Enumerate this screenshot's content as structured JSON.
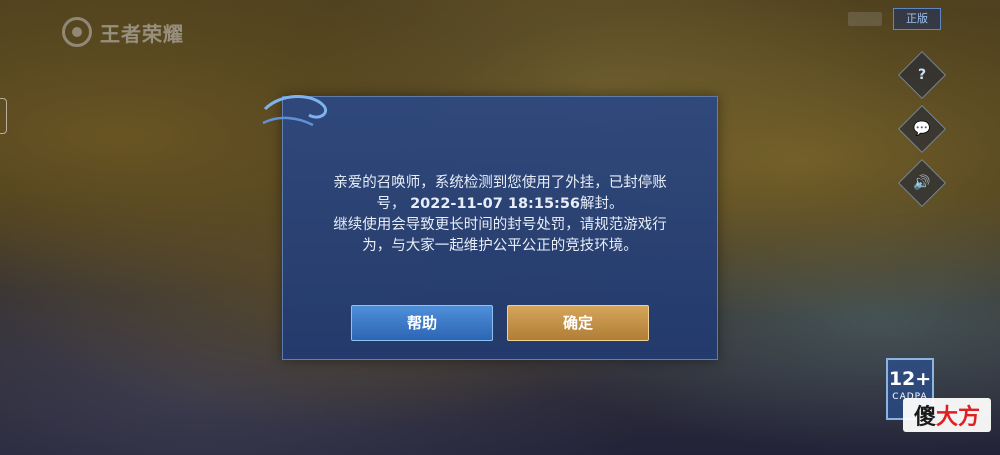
{
  "background": {
    "description_icon": "forest-scene"
  },
  "header": {
    "brand_label": "王者荣耀",
    "top_right_button": "正版"
  },
  "side_icons": [
    {
      "name": "help-icon",
      "glyph": "?"
    },
    {
      "name": "chat-icon",
      "glyph": "💬"
    },
    {
      "name": "sound-icon",
      "glyph": "🔊"
    }
  ],
  "age_rating": {
    "value": "12+",
    "label": "CADPA"
  },
  "dialog": {
    "line1": "亲爱的召唤师，系统检测到您使用了外挂，已封停账",
    "line2_prefix": "号，",
    "unban_time": "2022-11-07 18:15:56",
    "line2_suffix": "解封。",
    "line3": "继续使用会导致更长时间的封号处罚，请规范游戏行",
    "line4": "为，与大家一起维护公平公正的竞技环境。",
    "help_button": "帮助",
    "confirm_button": "确定"
  },
  "watermark": {
    "part1": "傻",
    "part2": "大方"
  },
  "colors": {
    "dialog_bg": "#2d4a80",
    "help_button": "#3a78c8",
    "confirm_button": "#c4913f"
  }
}
